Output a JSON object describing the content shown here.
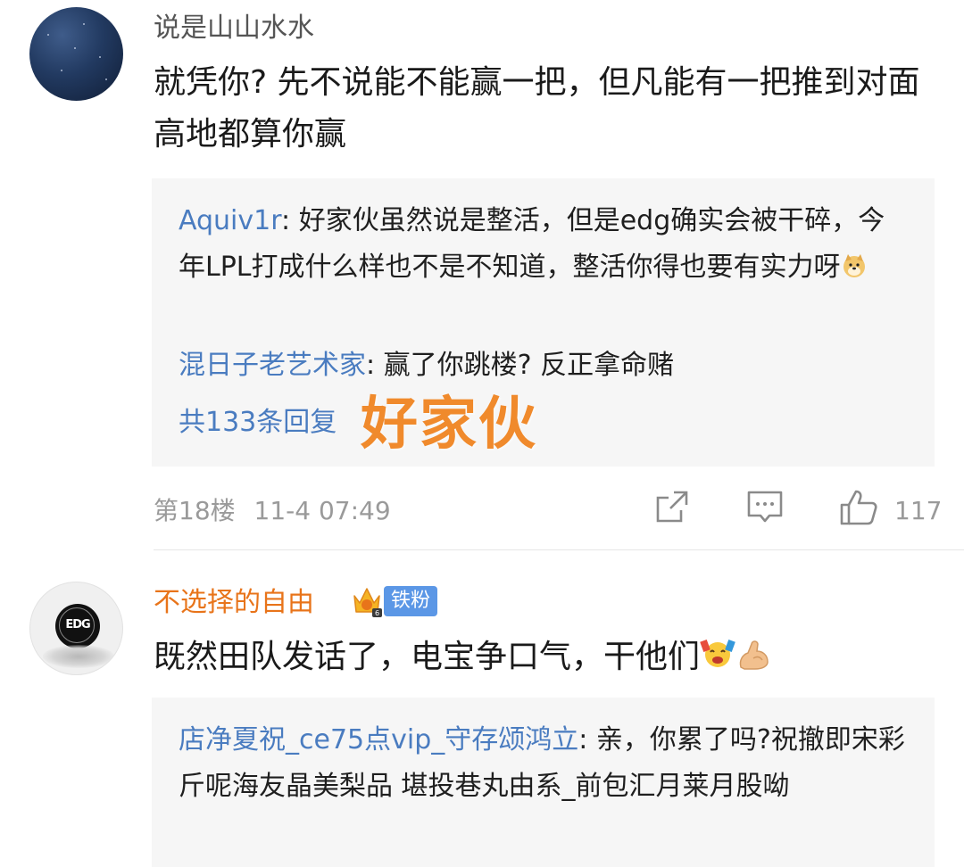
{
  "comment1": {
    "username": "说是山山水水",
    "content": "就凭你? 先不说能不能赢一把，但凡能有一把推到对面高地都算你赢",
    "replies": [
      {
        "name": "Aquiv1r",
        "sep": ": ",
        "text": "好家伙虽然说是整活，但是edg确实会被干碎，今年LPL打成什么样也不是不知道，整活你得也要有实力呀",
        "emoji": "doge-emoji"
      },
      {
        "name": "混日子老艺术家",
        "sep": ": ",
        "text": "赢了你跳楼? 反正拿命赌"
      }
    ],
    "more_replies": "共133条回复",
    "overlay_text": "好家伙",
    "floor": "第18楼",
    "time": "11-4 07:49",
    "like_count": "117"
  },
  "comment2": {
    "username": "不选择的自由",
    "badge": "铁粉",
    "avatar_text": "EDG",
    "content": "既然田队发话了，电宝争口气，干他们",
    "emojis": [
      "cheer-emoji",
      "muscle-emoji"
    ],
    "replies": [
      {
        "name": "店净夏祝_ce75点vip_守存颂鸿立",
        "sep": ": ",
        "text": "亲，你累了吗?祝撤即宋彩斤呢海友晶美梨品  堪投巷丸由系_前包汇月莱月股呦"
      }
    ]
  },
  "colors": {
    "link": "#4a7cc0",
    "highlight_user": "#e8741a",
    "overlay": "#f08a2c",
    "meta": "#9a9a9a",
    "reply_bg": "#f6f6f6",
    "badge_bg": "#5b97e6"
  }
}
